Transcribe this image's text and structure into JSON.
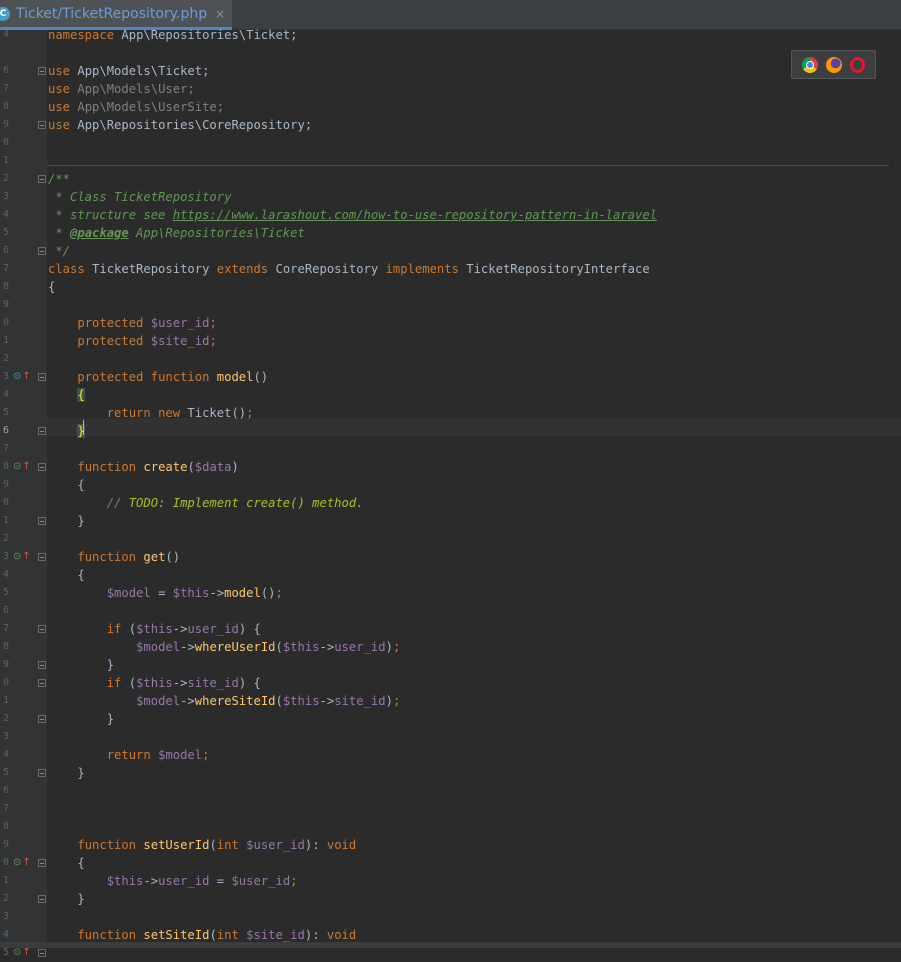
{
  "tab": {
    "icon_letter": "C",
    "title": "Ticket/TicketRepository.php",
    "close": "×"
  },
  "browsers": [
    "chrome-icon",
    "firefox-icon",
    "opera-icon"
  ],
  "gutter": {
    "line_numbers": [
      "4",
      "",
      "6",
      "7",
      "8",
      "9",
      "0",
      "1",
      "2",
      "3",
      "4",
      "5",
      "6",
      "7",
      "8",
      "9",
      "0",
      "1",
      "2",
      "3",
      "4",
      "5",
      "6",
      "7",
      "8",
      "9",
      "0",
      "1",
      "2",
      "3",
      "4",
      "5",
      "6",
      "7",
      "8",
      "9",
      "0",
      "1",
      "2",
      "3",
      "4",
      "5",
      "6",
      "7",
      "8",
      "9",
      "0",
      "1",
      "2",
      "3",
      "4",
      "5"
    ],
    "current": "6",
    "markers": [
      {
        "row": 19,
        "glyph": "⊙",
        "arrow": "↑"
      },
      {
        "row": 24,
        "glyph": "⊙",
        "arrow": "↑"
      },
      {
        "row": 29,
        "glyph": "⊙",
        "arrow": "↑"
      },
      {
        "row": 46,
        "glyph": "⊙",
        "arrow": "↑"
      },
      {
        "row": 51,
        "glyph": "⊙",
        "arrow": "↑"
      }
    ]
  },
  "code": [
    [
      [
        "kw",
        "namespace"
      ],
      [
        "",
        "App\\Repositories\\Ticket;"
      ]
    ],
    [],
    [
      [
        "kw",
        "use"
      ],
      [
        "",
        "App\\Models\\Ticket;"
      ]
    ],
    [
      [
        "kw",
        "use"
      ],
      [
        "unused",
        "App\\Models\\User;"
      ]
    ],
    [
      [
        "kw",
        "use"
      ],
      [
        "unused",
        "App\\Models\\UserSite;"
      ]
    ],
    [
      [
        "kw",
        "use"
      ],
      [
        "",
        "App\\Repositories\\CoreRepository;"
      ]
    ],
    [],
    [],
    [
      [
        "cm",
        "/**"
      ]
    ],
    [
      [
        "cm",
        " * Class TicketRepository"
      ]
    ],
    [
      [
        "cm",
        " * structure see "
      ],
      [
        "link",
        "https://www.larashout.com/how-to-use-repository-pattern-in-laravel"
      ]
    ],
    [
      [
        "cm",
        " * "
      ],
      [
        "dtag",
        "@package"
      ],
      [
        "cm",
        " App\\Repositories\\Ticket"
      ]
    ],
    [
      [
        "cm",
        " */"
      ]
    ],
    [
      [
        "kw",
        "class"
      ],
      [
        "",
        " TicketRepository "
      ],
      [
        "kw",
        "extends"
      ],
      [
        "",
        " CoreRepository "
      ],
      [
        "kw",
        "implements"
      ],
      [
        "",
        " TicketRepositoryInterface"
      ]
    ],
    [
      [
        "",
        "{"
      ]
    ],
    [],
    [
      [
        "",
        "    "
      ],
      [
        "kw",
        "protected"
      ],
      [
        "",
        " "
      ],
      [
        "var",
        "$user_id"
      ],
      [
        "kw",
        ";"
      ]
    ],
    [
      [
        "",
        "    "
      ],
      [
        "kw",
        "protected"
      ],
      [
        "",
        " "
      ],
      [
        "var",
        "$site_id"
      ],
      [
        "kw",
        ";"
      ]
    ],
    [],
    [
      [
        "",
        "    "
      ],
      [
        "kw",
        "protected function"
      ],
      [
        "",
        " "
      ],
      [
        "fn",
        "model"
      ],
      [
        "",
        "()"
      ]
    ],
    [
      [
        "",
        "    "
      ],
      [
        "brace-hl",
        "{"
      ]
    ],
    [
      [
        "",
        "        "
      ],
      [
        "kw",
        "return new"
      ],
      [
        "",
        " Ticket()"
      ],
      [
        "kw",
        ";"
      ]
    ],
    [
      [
        "",
        "    "
      ],
      [
        "brace-hl",
        "}"
      ]
    ],
    [],
    [
      [
        "",
        "    "
      ],
      [
        "kw",
        "function"
      ],
      [
        "",
        " "
      ],
      [
        "fn",
        "create"
      ],
      [
        "",
        "("
      ],
      [
        "var",
        "$data"
      ],
      [
        "",
        ")"
      ]
    ],
    [
      [
        "",
        "    {"
      ]
    ],
    [
      [
        "",
        "        "
      ],
      [
        "lc",
        "// "
      ],
      [
        "todo",
        "TODO: Implement create() method."
      ]
    ],
    [
      [
        "",
        "    }"
      ]
    ],
    [],
    [
      [
        "",
        "    "
      ],
      [
        "kw",
        "function"
      ],
      [
        "",
        " "
      ],
      [
        "fn",
        "get"
      ],
      [
        "",
        "()"
      ]
    ],
    [
      [
        "",
        "    {"
      ]
    ],
    [
      [
        "",
        "        "
      ],
      [
        "var",
        "$model"
      ],
      [
        "",
        " = "
      ],
      [
        "var",
        "$this"
      ],
      [
        "",
        "->"
      ],
      [
        "fn",
        "model"
      ],
      [
        "",
        "()"
      ],
      [
        "kw",
        ";"
      ]
    ],
    [],
    [
      [
        "",
        "        "
      ],
      [
        "kw",
        "if"
      ],
      [
        "",
        " ("
      ],
      [
        "var",
        "$this"
      ],
      [
        "",
        "->"
      ],
      [
        "var",
        "user_id"
      ],
      [
        "",
        ") {"
      ]
    ],
    [
      [
        "",
        "            "
      ],
      [
        "var",
        "$model"
      ],
      [
        "",
        "->"
      ],
      [
        "fn",
        "whereUserId"
      ],
      [
        "",
        "("
      ],
      [
        "var",
        "$this"
      ],
      [
        "",
        "->"
      ],
      [
        "var",
        "user_id"
      ],
      [
        "",
        ")"
      ],
      [
        "kw",
        ";"
      ]
    ],
    [
      [
        "",
        "        }"
      ]
    ],
    [
      [
        "",
        "        "
      ],
      [
        "kw",
        "if"
      ],
      [
        "",
        " ("
      ],
      [
        "var",
        "$this"
      ],
      [
        "",
        "->"
      ],
      [
        "var",
        "site_id"
      ],
      [
        "",
        ") {"
      ]
    ],
    [
      [
        "",
        "            "
      ],
      [
        "var",
        "$model"
      ],
      [
        "",
        "->"
      ],
      [
        "fn",
        "whereSiteId"
      ],
      [
        "",
        "("
      ],
      [
        "var",
        "$this"
      ],
      [
        "",
        "->"
      ],
      [
        "var",
        "site_id"
      ],
      [
        "",
        ")"
      ],
      [
        "kw",
        ";"
      ]
    ],
    [
      [
        "",
        "        }"
      ]
    ],
    [],
    [
      [
        "",
        "        "
      ],
      [
        "kw",
        "return"
      ],
      [
        "",
        " "
      ],
      [
        "var",
        "$model"
      ],
      [
        "kw",
        ";"
      ]
    ],
    [
      [
        "",
        "    }"
      ]
    ],
    [],
    [],
    [],
    [
      [
        "",
        "    "
      ],
      [
        "kw",
        "function"
      ],
      [
        "",
        " "
      ],
      [
        "fn",
        "setUserId"
      ],
      [
        "",
        "("
      ],
      [
        "kw",
        "int"
      ],
      [
        "",
        " "
      ],
      [
        "var",
        "$user_id"
      ],
      [
        "",
        "): "
      ],
      [
        "kw",
        "void"
      ]
    ],
    [
      [
        "",
        "    {"
      ]
    ],
    [
      [
        "",
        "        "
      ],
      [
        "var",
        "$this"
      ],
      [
        "",
        "->"
      ],
      [
        "var",
        "user_id"
      ],
      [
        "",
        " = "
      ],
      [
        "var",
        "$user_id"
      ],
      [
        "kw",
        ";"
      ]
    ],
    [
      [
        "",
        "    }"
      ]
    ],
    [],
    [
      [
        "",
        "    "
      ],
      [
        "kw",
        "function"
      ],
      [
        "",
        " "
      ],
      [
        "fn",
        "setSiteId"
      ],
      [
        "",
        "("
      ],
      [
        "kw",
        "int"
      ],
      [
        "",
        " "
      ],
      [
        "var",
        "$site_id"
      ],
      [
        "",
        "): "
      ],
      [
        "kw",
        "void"
      ]
    ]
  ]
}
